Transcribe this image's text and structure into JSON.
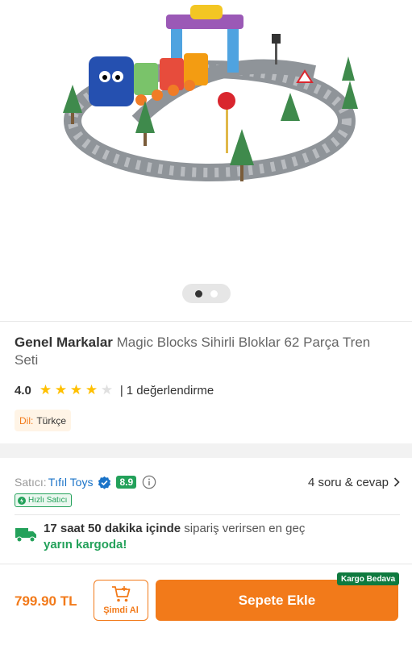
{
  "product": {
    "brand": "Genel Markalar",
    "name": "Magic Blocks Sihirli Bloklar 62 Parça Tren Seti",
    "image_icon": "train-set-product-image"
  },
  "gallery": {
    "slide_count": 2,
    "active_index": 0
  },
  "rating": {
    "value": "4.0",
    "stars": 4,
    "max_stars": 5,
    "separator": "|",
    "reviews_text": "1 değerlendirme"
  },
  "language": {
    "label": "Dil:",
    "value": "Türkçe"
  },
  "seller": {
    "label": "Satıcı:",
    "name": "Tıfıl Toys",
    "score": "8.9",
    "qa_link": "4 soru & cevap",
    "fast_seller_badge": "Hızlı Satıcı"
  },
  "delivery": {
    "time_strong": "17 saat 50 dakika içinde",
    "rest": " sipariş verirsen en geç",
    "arrival": "yarın kargoda!"
  },
  "purchase": {
    "price": "799.90 TL",
    "buy_now_label": "Şimdi Al",
    "add_to_cart_label": "Sepete Ekle",
    "free_shipping_badge": "Kargo Bedava"
  },
  "colors": {
    "accent": "#f27a1a",
    "green": "#23a15a",
    "link": "#1a73c8",
    "star": "#ffc000"
  }
}
